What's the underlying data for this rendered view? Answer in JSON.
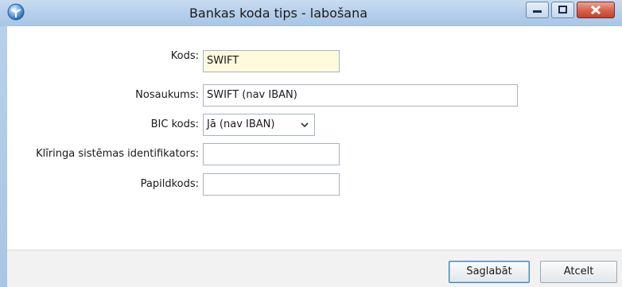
{
  "window": {
    "title": "Bankas koda tips - labošana",
    "icons": [
      "app-icon",
      "minimize-icon",
      "maximize-icon",
      "close-icon"
    ]
  },
  "form": {
    "kods": {
      "label": "Kods:",
      "value": "SWIFT"
    },
    "nosaukums": {
      "label": "Nosaukums:",
      "value": "SWIFT (nav IBAN)"
    },
    "bic_kods": {
      "label": "BIC kods:",
      "value": "Jā (nav IBAN)"
    },
    "kliringa": {
      "label": "Klīringa sistēmas identifikators:",
      "value": ""
    },
    "papildkods": {
      "label": "Papildkods:",
      "value": ""
    }
  },
  "buttons": {
    "save": "Saglabāt",
    "cancel": "Atcelt"
  },
  "colors": {
    "titlebar": "#b5cfeb",
    "focused_input": "#fefadc",
    "close_button": "#d7654f"
  }
}
